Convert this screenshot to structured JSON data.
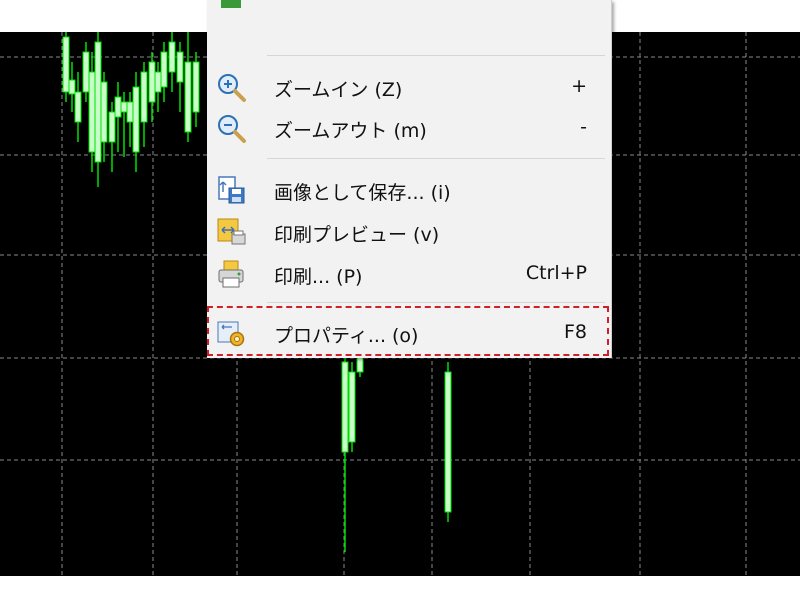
{
  "menu": {
    "items": [
      {
        "label": "ズームイン (Z)",
        "shortcut": "+",
        "icon": "zoom-in-icon"
      },
      {
        "label": "ズームアウト (m)",
        "shortcut": "-",
        "icon": "zoom-out-icon"
      },
      {
        "label": "画像として保存... (i)",
        "shortcut": "",
        "icon": "save-image-icon"
      },
      {
        "label": "印刷プレビュー (v)",
        "shortcut": "",
        "icon": "print-preview-icon"
      },
      {
        "label": "印刷... (P)",
        "shortcut": "Ctrl+P",
        "icon": "print-icon"
      },
      {
        "label": "プロパティ... (o)",
        "shortcut": "F8",
        "icon": "properties-icon"
      }
    ]
  },
  "colors": {
    "chart_background": "#000000",
    "grid": "#8a8a8a",
    "candle": "#00e000",
    "candle_body": "#c8ffc8",
    "highlight": "#d0202a"
  }
}
